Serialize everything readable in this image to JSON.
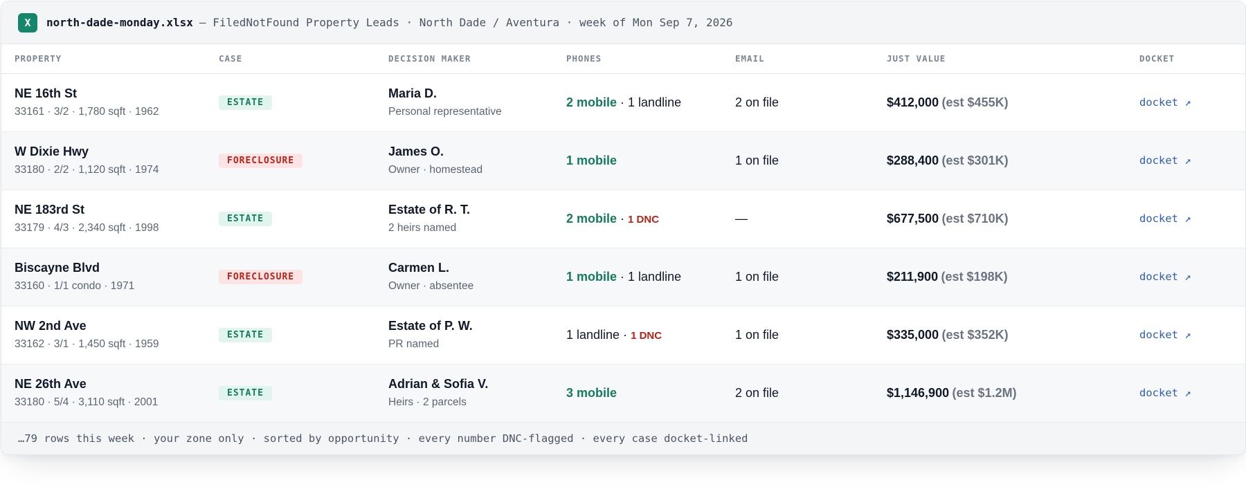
{
  "titlebar": {
    "icon_letter": "X",
    "filename": "north-dade-monday.xlsx",
    "subtitle": "— FiledNotFound Property Leads · North Dade / Aventura · week of Mon Sep 7, 2026"
  },
  "table": {
    "headers": {
      "property": "PROPERTY",
      "case": "CASE",
      "decision_maker": "DECISION MAKER",
      "phones": "PHONES",
      "email": "EMAIL",
      "just_value": "JUST VALUE",
      "docket": "DOCKET"
    },
    "rows": [
      {
        "address": "NE 16th St",
        "details": "33161 · 3/2 · 1,780 sqft · 1962",
        "case": "ESTATE",
        "case_type": "estate",
        "dm_name": "Maria D.",
        "dm_role": "Personal representative",
        "phone_primary": "2 mobile",
        "phone_primary_type": "mobile",
        "phone_secondary": "1 landline",
        "phone_secondary_type": "plain",
        "email": "2 on file",
        "value": "$412,000",
        "est": "(est $455K)",
        "docket": "docket ↗"
      },
      {
        "address": "W Dixie Hwy",
        "details": "33180 · 2/2 · 1,120 sqft · 1974",
        "case": "FORECLOSURE",
        "case_type": "foreclosure",
        "dm_name": "James O.",
        "dm_role": "Owner · homestead",
        "phone_primary": "1 mobile",
        "phone_primary_type": "mobile",
        "phone_secondary": "",
        "phone_secondary_type": "plain",
        "email": "1 on file",
        "value": "$288,400",
        "est": "(est $301K)",
        "docket": "docket ↗"
      },
      {
        "address": "NE 183rd St",
        "details": "33179 · 4/3 · 2,340 sqft · 1998",
        "case": "ESTATE",
        "case_type": "estate",
        "dm_name": "Estate of R. T.",
        "dm_role": "2 heirs named",
        "phone_primary": "2 mobile",
        "phone_primary_type": "mobile",
        "phone_secondary": "1 DNC",
        "phone_secondary_type": "dnc",
        "email": "—",
        "value": "$677,500",
        "est": "(est $710K)",
        "docket": "docket ↗"
      },
      {
        "address": "Biscayne Blvd",
        "details": "33160 · 1/1 condo · 1971",
        "case": "FORECLOSURE",
        "case_type": "foreclosure",
        "dm_name": "Carmen L.",
        "dm_role": "Owner · absentee",
        "phone_primary": "1 mobile",
        "phone_primary_type": "mobile",
        "phone_secondary": "1 landline",
        "phone_secondary_type": "plain",
        "email": "1 on file",
        "value": "$211,900",
        "est": "(est $198K)",
        "docket": "docket ↗"
      },
      {
        "address": "NW 2nd Ave",
        "details": "33162 · 3/1 · 1,450 sqft · 1959",
        "case": "ESTATE",
        "case_type": "estate",
        "dm_name": "Estate of P. W.",
        "dm_role": "PR named",
        "phone_primary": "1 landline",
        "phone_primary_type": "plain",
        "phone_secondary": "1 DNC",
        "phone_secondary_type": "dnc",
        "email": "1 on file",
        "value": "$335,000",
        "est": "(est $352K)",
        "docket": "docket ↗"
      },
      {
        "address": "NE 26th Ave",
        "details": "33180 · 5/4 · 3,110 sqft · 2001",
        "case": "ESTATE",
        "case_type": "estate",
        "dm_name": "Adrian & Sofia V.",
        "dm_role": "Heirs · 2 parcels",
        "phone_primary": "3 mobile",
        "phone_primary_type": "mobile",
        "phone_secondary": "",
        "phone_secondary_type": "plain",
        "email": "2 on file",
        "value": "$1,146,900",
        "est": "(est $1.2M)",
        "docket": "docket ↗"
      }
    ]
  },
  "footer": {
    "text": "…79 rows this week · your zone only · sorted by opportunity · every number DNC-flagged · every case docket-linked"
  },
  "colors": {
    "estate_badge_bg": "#e1f4ee",
    "estate_badge_text": "#157a5e",
    "foreclosure_badge_bg": "#fde4e4",
    "foreclosure_badge_text": "#b42318",
    "mobile_text": "#157a5e",
    "dnc_text": "#b42318",
    "docket_link": "#2f5db3",
    "icon_bg": "#14866a"
  }
}
